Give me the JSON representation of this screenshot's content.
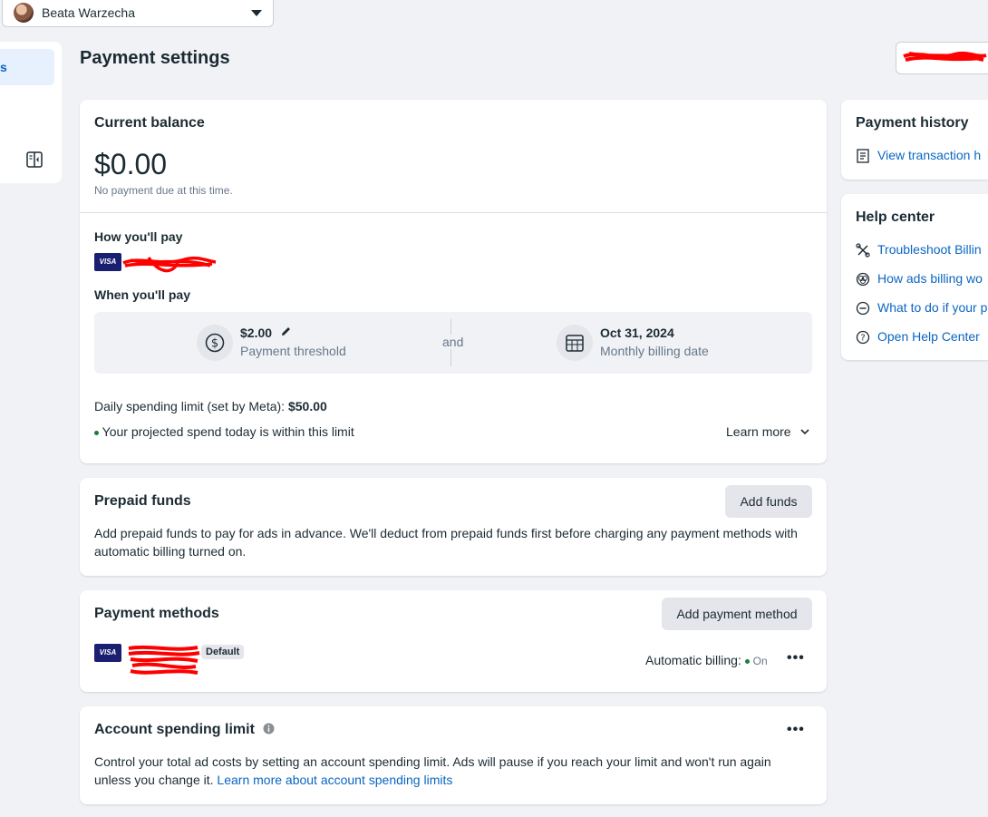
{
  "account": {
    "name": "Beata Warzecha"
  },
  "nav": {
    "active_label": "s"
  },
  "page": {
    "title": "Payment settings"
  },
  "balance": {
    "title": "Current balance",
    "amount": "$0.00",
    "note": "No payment due at this time.",
    "how_pay_label": "How you'll pay",
    "when_pay_label": "When you'll pay",
    "threshold_value": "$2.00",
    "threshold_label": "Payment threshold",
    "and_text": "and",
    "billing_date_value": "Oct 31, 2024",
    "billing_date_label": "Monthly billing date",
    "daily_limit_prefix": "Daily spending limit (set by Meta): ",
    "daily_limit_value": "$50.00",
    "projected_note": "Your projected spend today is within this limit",
    "learn_more": "Learn more"
  },
  "prepaid": {
    "title": "Prepaid funds",
    "add_button": "Add funds",
    "description": "Add prepaid funds to pay for ads in advance. We'll deduct from prepaid funds first before charging any payment methods with automatic billing turned on."
  },
  "payment_methods": {
    "title": "Payment methods",
    "add_button": "Add payment method",
    "default_badge": "Default",
    "auto_billing_label": "Automatic billing:",
    "auto_billing_status": "On",
    "card_brand": "VISA"
  },
  "spending_limit": {
    "title": "Account spending limit",
    "description": "Control your total ad costs by setting an account spending limit. Ads will pause if you reach your limit and won't run again unless you change it. ",
    "link": "Learn more about account spending limits"
  },
  "payment_history": {
    "title": "Payment history",
    "link": "View transaction h"
  },
  "help_center": {
    "title": "Help center",
    "links": [
      "Troubleshoot Billin",
      "How ads billing wo",
      "What to do if your p",
      "Open Help Center"
    ]
  },
  "colors": {
    "link": "#0a66c2",
    "status_on": "#1a7f37",
    "visa": "#1a1f71",
    "redaction": "#ff0000"
  }
}
